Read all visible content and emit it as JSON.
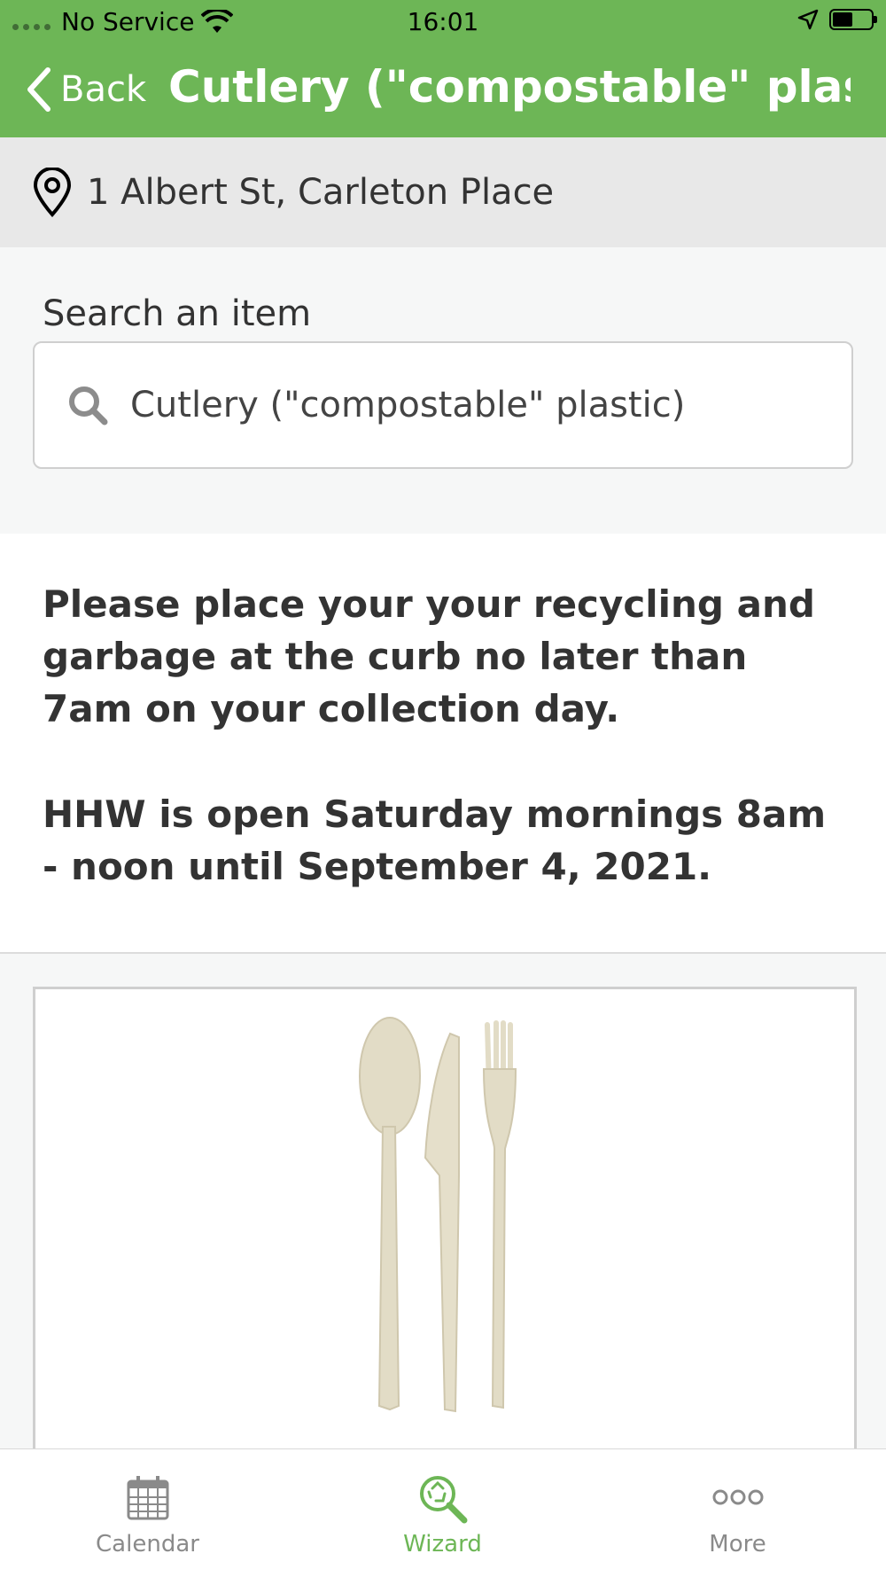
{
  "status_bar": {
    "carrier": "No Service",
    "time": "16:01"
  },
  "nav": {
    "back_label": "Back",
    "title": "Cutlery (\"compostable\" plast..."
  },
  "address": {
    "text": "1 Albert St, Carleton Place"
  },
  "search": {
    "label": "Search an item",
    "value": "Cutlery (\"compostable\" plastic)"
  },
  "message": {
    "paragraph1": "Please place your your recycling and garbage at the curb no later than 7am on your collection day.",
    "paragraph2": "HHW is open Saturday mornings 8am - noon until September 4, 2021."
  },
  "item_image": {
    "icon": "cutlery-image"
  },
  "tabs": [
    {
      "label": "Calendar",
      "icon": "calendar-icon",
      "active": false
    },
    {
      "label": "Wizard",
      "icon": "wizard-icon",
      "active": true
    },
    {
      "label": "More",
      "icon": "more-icon",
      "active": false
    }
  ],
  "colors": {
    "brand_green": "#6db656",
    "inactive_tab": "#8a8a8a"
  }
}
